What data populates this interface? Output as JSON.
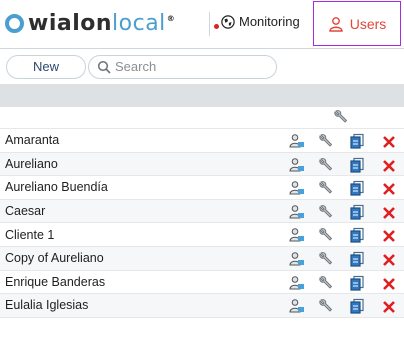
{
  "header": {
    "logo_main": "wialon",
    "logo_suffix": "local",
    "logo_mark": "®",
    "nav_monitoring": "Monitoring",
    "nav_users": "Users"
  },
  "toolbar": {
    "new_label": "New",
    "search_placeholder": "Search"
  },
  "users": [
    {
      "name": "Amaranta"
    },
    {
      "name": "Aureliano"
    },
    {
      "name": "Aureliano Buendía"
    },
    {
      "name": "Caesar"
    },
    {
      "name": "Cliente 1"
    },
    {
      "name": "Copy of Aureliano"
    },
    {
      "name": "Enrique Banderas"
    },
    {
      "name": "Eulalia Iglesias"
    }
  ],
  "icons": {
    "row_actions": [
      "user-access-icon",
      "wrench-icon",
      "copy-icon",
      "delete-icon"
    ]
  },
  "colors": {
    "accent": "#4a9fd0",
    "users_tab_text": "#e0473a",
    "users_tab_border": "#a52de0",
    "delete": "#e02020"
  }
}
